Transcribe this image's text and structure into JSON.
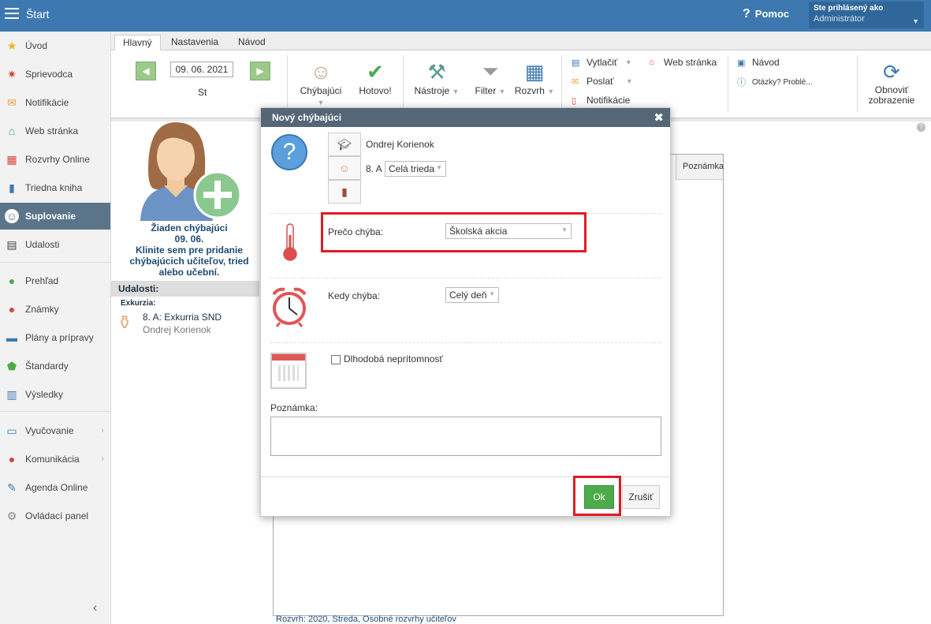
{
  "topbar": {
    "title": "Štart",
    "help_label": "Pomoc",
    "user_label": "Ste prihlásený ako",
    "user_name": "Administrátor"
  },
  "sidebar": {
    "items": [
      {
        "label": "Úvod",
        "icon": "star-icon"
      },
      {
        "label": "Sprievodca",
        "icon": "wand-icon"
      },
      {
        "label": "Notifikácie",
        "icon": "envelope-icon"
      },
      {
        "label": "Web stránka",
        "icon": "house-icon"
      },
      {
        "label": "Rozvrhy Online",
        "icon": "timetable-icon"
      },
      {
        "label": "Triedna kniha",
        "icon": "book-icon"
      },
      {
        "label": "Suplovanie",
        "icon": "user-icon"
      },
      {
        "label": "Udalosti",
        "icon": "calendar-icon"
      },
      {
        "label": "Prehľad",
        "icon": "check-circle-icon"
      },
      {
        "label": "Známky",
        "icon": "chart-icon"
      },
      {
        "label": "Plány a prípravy",
        "icon": "briefcase-icon"
      },
      {
        "label": "Štandardy",
        "icon": "shield-icon"
      },
      {
        "label": "Výsledky",
        "icon": "bar-chart-icon"
      },
      {
        "label": "Vyučovanie",
        "icon": "open-book-icon"
      },
      {
        "label": "Komunikácia",
        "icon": "chat-icon"
      },
      {
        "label": "Agenda Online",
        "icon": "pencil-icon"
      },
      {
        "label": "Ovládací panel",
        "icon": "gear-icon"
      }
    ]
  },
  "tabs": [
    "Hlavný",
    "Nastavenia",
    "Návod"
  ],
  "ribbon": {
    "date": "09. 06. 2021",
    "day": "St",
    "missing_btn": "Chýbajúci",
    "done_btn": "Hotovo!",
    "tools_btn": "Nástroje",
    "filter_btn": "Filter",
    "timetable_btn": "Rozvrh",
    "print_btn": "Vytlačiť",
    "send_btn": "Poslať",
    "notifications_btn": "Notifikácie",
    "web_btn": "Web stránka",
    "guide_btn": "Návod",
    "questions_btn": "Otázky? Problé...",
    "refresh_btn_l1": "Obnoviť",
    "refresh_btn_l2": "zobrazenie"
  },
  "left_panel": {
    "missing_title": "Žiaden chýbajúci",
    "missing_date": "09. 06.",
    "missing_hint": "Klinite sem pre pridanie chýbajúcich učiteľov, tried alebo učební.",
    "events_head": "Udalosti:",
    "events_sub": "Exkurzia:",
    "event_title": "8. A: Exkurria SND",
    "event_person": "Ondrej Korienok"
  },
  "bg": {
    "table_header": "Poznámka",
    "status": "Rozvrh: 2020, Streda, Osobné rozvrhy učiteľov"
  },
  "modal": {
    "title": "Nový chýbajúci",
    "teacher": "Ondrej Korienok",
    "class": "8. A",
    "class_scope": "Celá trieda",
    "why_label": "Prečo chýba:",
    "why_value": "Školská akcia",
    "when_label": "Kedy chýba:",
    "when_value": "Celý deň",
    "longterm_label": "Dlhodobá neprítomnosť",
    "note_label": "Poznámka:",
    "ok": "Ok",
    "cancel": "Zrušiť"
  },
  "colors": {
    "topbar": "#3d79b0",
    "active_sidebar": "#5a7589",
    "modal_header": "#556677",
    "ok_button": "#4cab4a",
    "highlight": "#e01a22"
  }
}
